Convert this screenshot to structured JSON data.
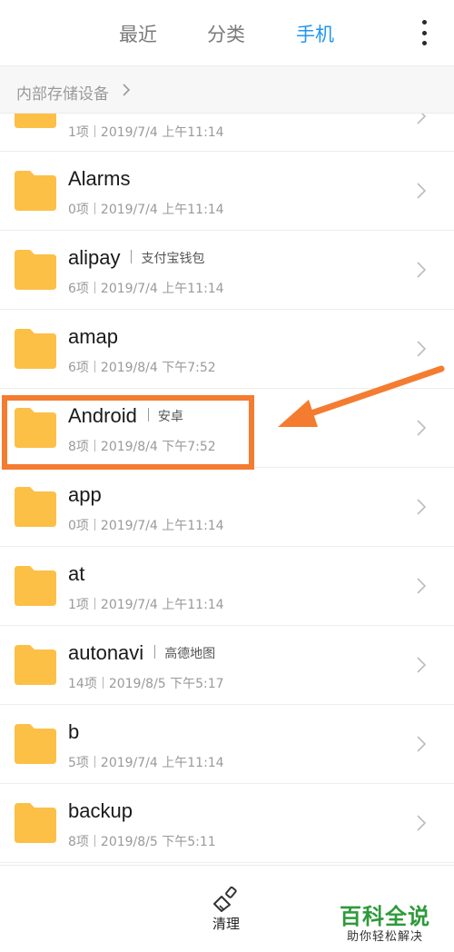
{
  "tabs": [
    {
      "label": "最近",
      "active": false
    },
    {
      "label": "分类",
      "active": false
    },
    {
      "label": "手机",
      "active": true
    }
  ],
  "breadcrumb": {
    "label": "内部存储设备"
  },
  "folders": [
    {
      "name": "",
      "alias": "",
      "count": "1项",
      "date": "2019/7/4 上午11:14"
    },
    {
      "name": "Alarms",
      "alias": "",
      "count": "0项",
      "date": "2019/7/4 上午11:14"
    },
    {
      "name": "alipay",
      "alias": "支付宝钱包",
      "count": "6项",
      "date": "2019/7/4 上午11:14"
    },
    {
      "name": "amap",
      "alias": "",
      "count": "6项",
      "date": "2019/8/4 下午7:52"
    },
    {
      "name": "Android",
      "alias": "安卓",
      "count": "8项",
      "date": "2019/8/4 下午7:52"
    },
    {
      "name": "app",
      "alias": "",
      "count": "0项",
      "date": "2019/7/4 上午11:14"
    },
    {
      "name": "at",
      "alias": "",
      "count": "1项",
      "date": "2019/7/4 上午11:14"
    },
    {
      "name": "autonavi",
      "alias": "高德地图",
      "count": "14项",
      "date": "2019/8/5 下午5:17"
    },
    {
      "name": "b",
      "alias": "",
      "count": "5项",
      "date": "2019/7/4 上午11:14"
    },
    {
      "name": "backup",
      "alias": "",
      "count": "8项",
      "date": "2019/8/5 下午5:11"
    }
  ],
  "bottom": {
    "clean_label": "清理"
  },
  "watermark": {
    "title": "百科全说",
    "subtitle": "助你轻松解决"
  },
  "colors": {
    "accent": "#2196f3",
    "folder": "#fcc046",
    "annotation": "#f47c30",
    "watermark": "#2e9a3a"
  },
  "icons": {
    "more": "more-vert-icon",
    "folder": "folder-icon",
    "chevron": "chevron-right-icon",
    "clean": "broom-icon"
  }
}
